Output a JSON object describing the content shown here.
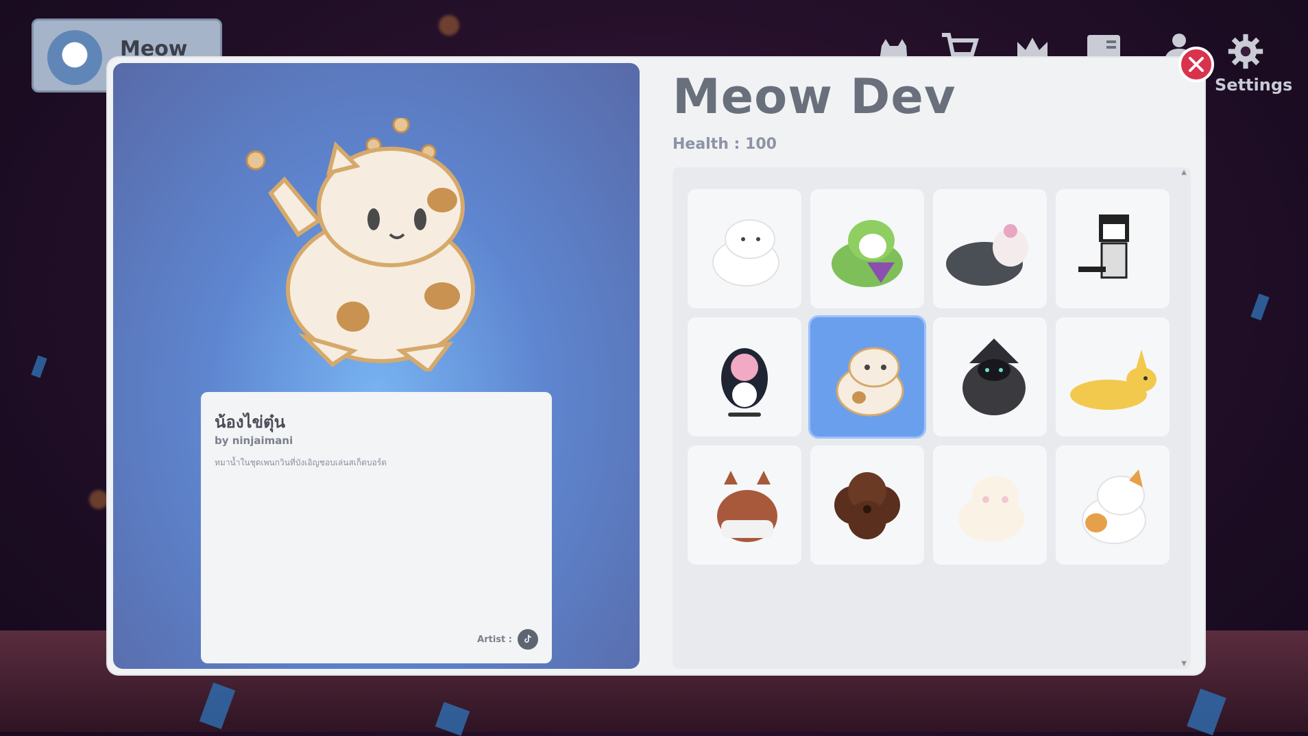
{
  "profile": {
    "name": "Meow Dev"
  },
  "nav": {
    "settings_label": "Settings"
  },
  "modal": {
    "title": "Meow Dev",
    "health": "Health : 100",
    "card": {
      "name": "น้องไข่ตุ๋น",
      "author": "by ninjaimani",
      "description": "หมาน้ำในชุดเพนกวินที่บังเอิญชอบเล่นสเก็ตบอร์ด",
      "artist_label": "Artist :"
    }
  },
  "colors": {
    "accent": "#6a9fee",
    "close": "#d9324c",
    "panel": "#f1f2f4"
  },
  "icons": [
    "cat-silhouette-icon",
    "cart-icon",
    "crown-icon",
    "book-icon",
    "user-icon",
    "gear-icon",
    "close-icon",
    "tiktok-icon"
  ],
  "grid": {
    "selected_index": 5,
    "count": 12
  }
}
